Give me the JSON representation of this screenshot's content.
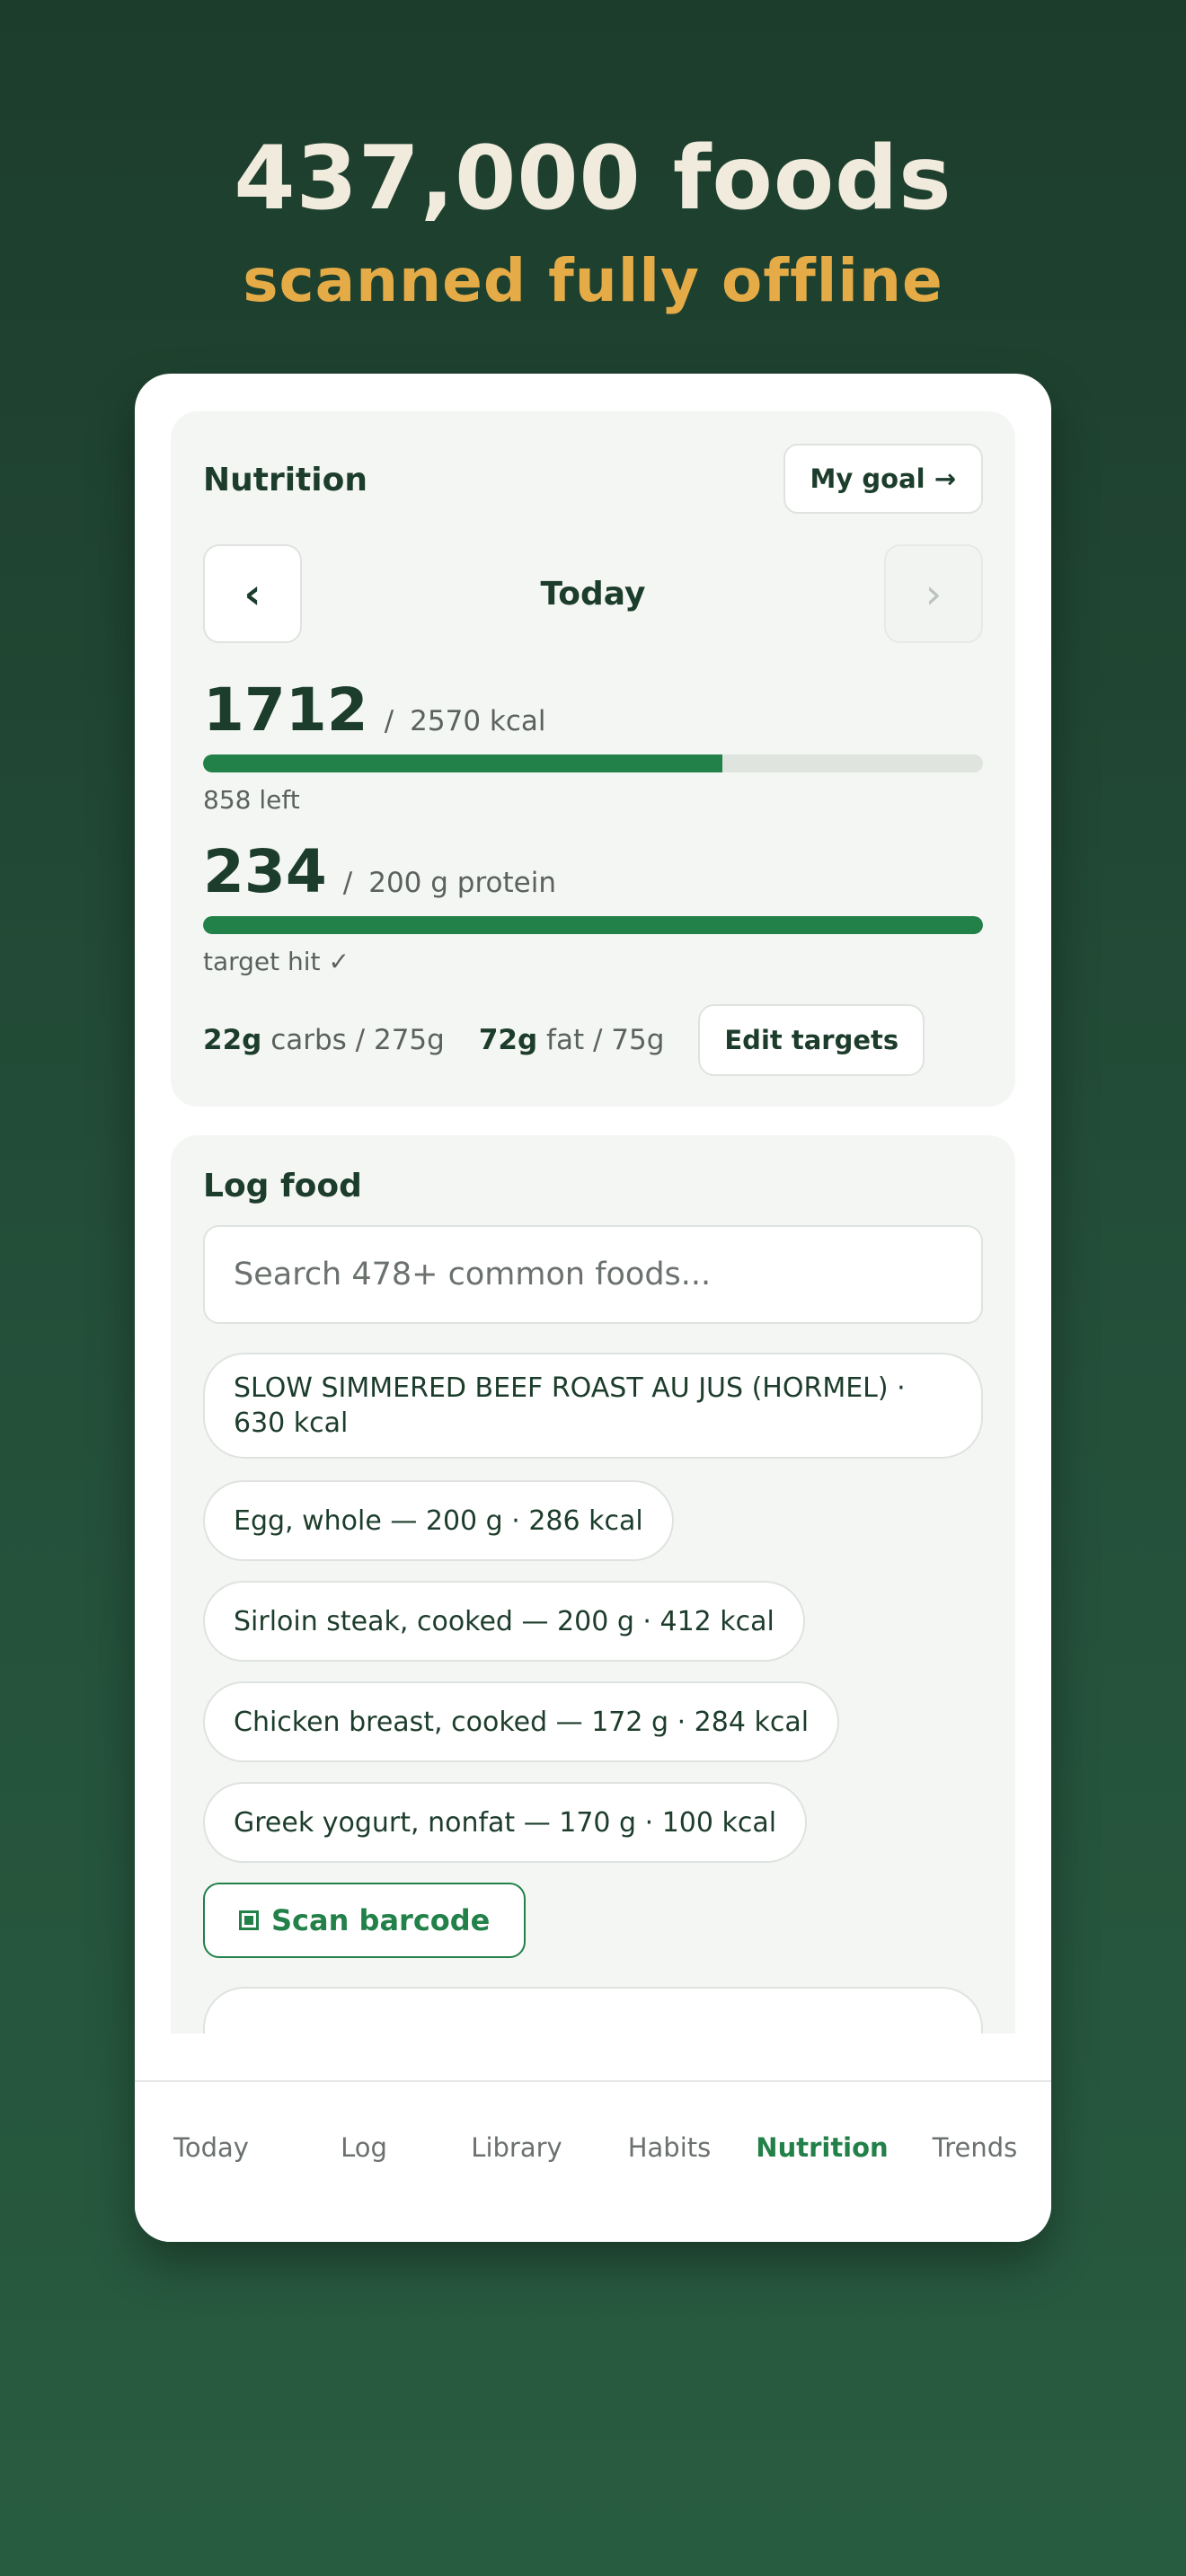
{
  "hero": {
    "headline": "437,000 foods",
    "subline": "scanned fully offline"
  },
  "nutrition": {
    "title": "Nutrition",
    "goal_button": "My goal →",
    "day": "Today",
    "prev_icon": "chevron-left-icon",
    "next_icon": "chevron-right-icon",
    "calories": {
      "current": "1712",
      "target": "2570 kcal",
      "progress": 0.666,
      "note": "858 left"
    },
    "protein": {
      "current": "234",
      "target": "200 g protein",
      "progress": 1.0,
      "note": "target hit ✓"
    },
    "macros": {
      "carbs_value": "22g",
      "carbs_rest": "carbs / 275g",
      "fat_value": "72g",
      "fat_rest": "fat / 75g"
    },
    "edit_button": "Edit targets"
  },
  "log": {
    "title": "Log food",
    "search_placeholder": "Search 478+ common foods...",
    "items": [
      "SLOW SIMMERED BEEF ROAST AU JUS (HORMEL) · 630 kcal",
      "Egg, whole — 200 g · 286 kcal",
      "Sirloin steak, cooked — 200 g · 412 kcal",
      "Chicken breast, cooked — 172 g · 284 kcal",
      "Greek yogurt, nonfat — 170 g · 100 kcal"
    ],
    "scan_button": "Scan barcode",
    "scan_icon": "barcode-icon"
  },
  "tabs": [
    "Today",
    "Log",
    "Library",
    "Habits",
    "Nutrition",
    "Trends"
  ],
  "active_tab": "Nutrition",
  "colors": {
    "accent": "#228049",
    "dark": "#1d3d2c",
    "gold": "#e5ab47"
  }
}
